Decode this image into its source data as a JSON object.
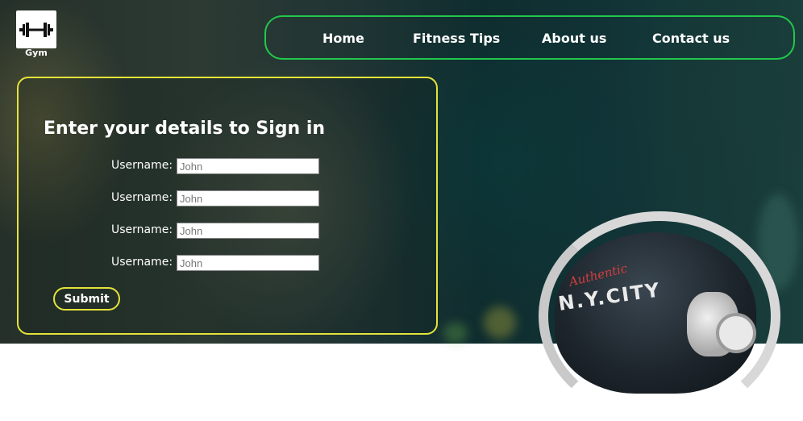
{
  "logo": {
    "label": "Gym",
    "icon": "dumbbell-icon"
  },
  "nav": {
    "items": [
      {
        "label": "Home"
      },
      {
        "label": "Fitness Tips"
      },
      {
        "label": "About us"
      },
      {
        "label": "Contact us"
      }
    ]
  },
  "form": {
    "heading": "Enter your details to Sign in",
    "fields": [
      {
        "label": "Username:",
        "placeholder": "John"
      },
      {
        "label": "Username:",
        "placeholder": "John"
      },
      {
        "label": "Username:",
        "placeholder": "John"
      },
      {
        "label": "Username:",
        "placeholder": "John"
      }
    ],
    "submit_label": "Submit"
  },
  "colors": {
    "nav_border": "#22c84c",
    "card_border": "#e4e33a",
    "background": "#1f3434"
  }
}
